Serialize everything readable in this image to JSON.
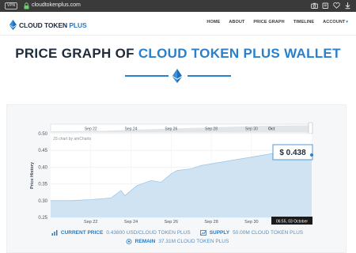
{
  "browser": {
    "badge": "VPN",
    "url": "cloudtokenplus.com"
  },
  "header": {
    "logo_main": "CLOUD TOKEN ",
    "logo_accent": "PLUS",
    "nav": [
      {
        "label": "HOME"
      },
      {
        "label": "ABOUT"
      },
      {
        "label": "PRICE GRAPH"
      },
      {
        "label": "TIMELINE"
      },
      {
        "label": "ACCOUNT"
      }
    ],
    "account_caret": "▾"
  },
  "hero": {
    "title_main": "PRICE GRAPH OF ",
    "title_accent": "CLOUD TOKEN PLUS WALLET"
  },
  "colors": {
    "brand": "#2a80cc",
    "area_fill": "#cfe3f2",
    "line": "#9fc7e6",
    "dark": "#1f2b3a"
  },
  "chart_data": {
    "type": "area",
    "credit": "JS chart by amCharts",
    "ylabel": "Price History",
    "ylim": [
      0.25,
      0.5
    ],
    "y_ticks": [
      "0.50",
      "0.45",
      "0.40",
      "0.35",
      "0.30",
      "0.25"
    ],
    "x_ticks": [
      "Sep 22",
      "Sep 24",
      "Sep 26",
      "Sep 28",
      "Sep 30"
    ],
    "scrollbar_ticks": [
      "Sep 22",
      "Sep 24",
      "Sep 26",
      "Sep 28",
      "Sep 30",
      "Oct"
    ],
    "series": [
      {
        "x": [
          "Sep 20",
          "Sep 21",
          "Sep 22",
          "Sep 23",
          "Sep 23.5",
          "Sep 23.7",
          "Sep 24",
          "Sep 24.3",
          "Sep 25",
          "Sep 25.5",
          "Sep 26",
          "Sep 26.3",
          "Sep 27",
          "Sep 27.5",
          "Sep 28",
          "Sep 29",
          "Sep 30",
          "Oct 01",
          "Oct 02",
          "Oct 03"
        ],
        "y": [
          0.3,
          0.3,
          0.303,
          0.308,
          0.33,
          0.315,
          0.33,
          0.345,
          0.36,
          0.355,
          0.38,
          0.39,
          0.395,
          0.405,
          0.41,
          0.42,
          0.43,
          0.44,
          0.446,
          0.438
        ]
      }
    ],
    "tooltip_value": "$ 0.438",
    "cursor_label": "06:55, 03 October"
  },
  "stats": {
    "current_label": "CURRENT PRICE",
    "current_value": "0.43800 USD/CLOUD TOKEN PLUS",
    "supply_label": "SUPPLY",
    "supply_value": "50.00M CLOUD TOKEN PLUS",
    "remain_label": "REMAIN",
    "remain_value": "37.31M CLOUD TOKEN PLUS"
  }
}
